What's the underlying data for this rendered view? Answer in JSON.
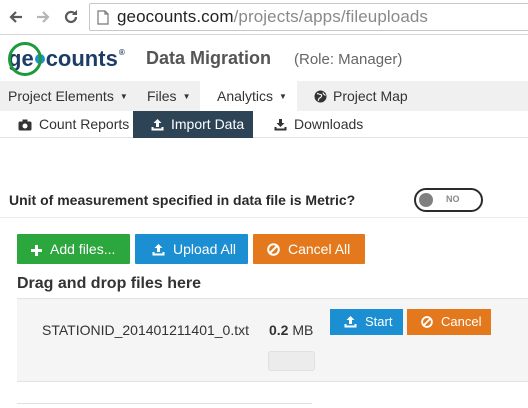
{
  "browser": {
    "url_host": "geocounts.com",
    "url_path": "/projects/apps/fileuploads"
  },
  "header": {
    "logo_prefix": "ge",
    "logo_suffix": "counts",
    "logo_reg": "®",
    "title": "Data Migration",
    "role": "(Role: Manager)"
  },
  "menu": [
    {
      "label": "Project Elements",
      "caret": "▼"
    },
    {
      "label": "Files",
      "caret": "▼"
    },
    {
      "label": "Analytics",
      "caret": "▼"
    },
    {
      "label": "Project Map"
    }
  ],
  "subtabs": [
    {
      "label": "Count Reports"
    },
    {
      "label": "Import Data"
    },
    {
      "label": "Downloads"
    }
  ],
  "metric": {
    "question": "Unit of measurement specified in data file is Metric?",
    "toggle_text": "NO",
    "toggle_on": false
  },
  "actions": {
    "add": "Add files...",
    "upload": "Upload All",
    "cancel": "Cancel All"
  },
  "dropzone_title": "Drag and drop files here",
  "file": {
    "name": "STATIONID_201401211401_0.txt",
    "size_value": "0.2",
    "size_unit": "MB",
    "progress": 0,
    "start_label": "Start",
    "cancel_label": "Cancel"
  },
  "colors": {
    "green": "#2ba73e",
    "blue": "#1b8fd2",
    "orange": "#e3781c",
    "active_tab": "#2d4356"
  }
}
